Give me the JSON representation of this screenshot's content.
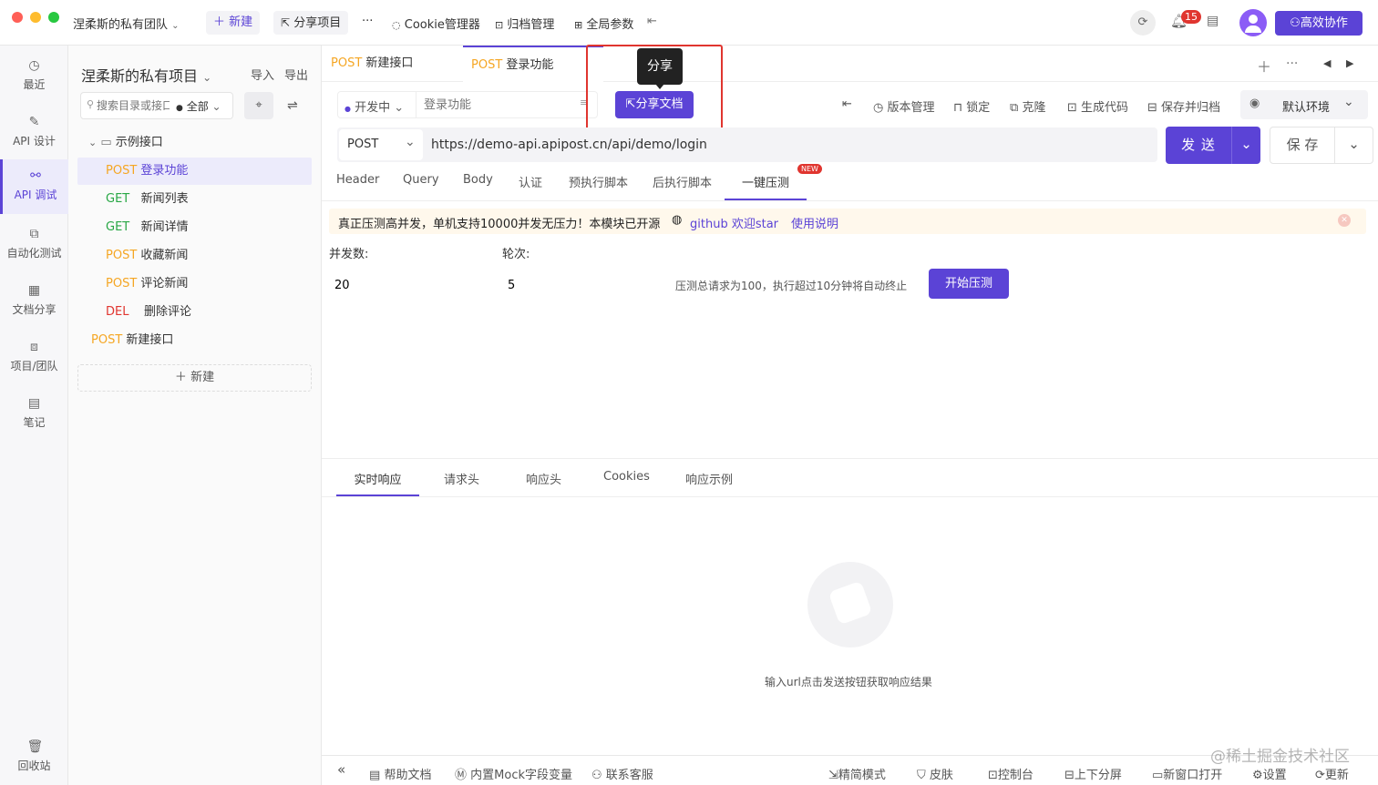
{
  "titlebar": {
    "team": "涅柔斯的私有团队",
    "new_label": "新建",
    "share_project": "分享项目",
    "more": "···",
    "cookie": "Cookie管理器",
    "archive": "归档管理",
    "global_params": "全局参数",
    "notif_count": "15",
    "collab": "高效协作"
  },
  "leftnav": [
    {
      "label": "最近",
      "icon": "clock-icon"
    },
    {
      "label": "API 设计",
      "icon": "edit-icon"
    },
    {
      "label": "API 调试",
      "icon": "link-icon"
    },
    {
      "label": "自动化测试",
      "icon": "flow-icon"
    },
    {
      "label": "文档分享",
      "icon": "doc-icon"
    },
    {
      "label": "项目/团队",
      "icon": "stack-icon"
    },
    {
      "label": "笔记",
      "icon": "note-icon"
    },
    {
      "label": "回收站",
      "icon": "trash-icon"
    }
  ],
  "tree": {
    "project": "涅柔斯的私有项目",
    "import": "导入",
    "export": "导出",
    "search_placeholder": "搜索目录或接口",
    "filter": "全部",
    "folder": "示例接口",
    "items": [
      {
        "method": "POST",
        "name": "登录功能"
      },
      {
        "method": "GET",
        "name": "新闻列表"
      },
      {
        "method": "GET",
        "name": "新闻详情"
      },
      {
        "method": "POST",
        "name": "收藏新闻"
      },
      {
        "method": "POST",
        "name": "评论新闻"
      },
      {
        "method": "DEL",
        "name": "删除评论"
      }
    ],
    "root_item": {
      "method": "POST",
      "name": "新建接口"
    },
    "new_button": "新建"
  },
  "tabs": [
    {
      "method": "POST",
      "name": "新建接口"
    },
    {
      "method": "POST",
      "name": "登录功能"
    }
  ],
  "tooltip": "分享",
  "toolbar": {
    "status": "开发中",
    "name_placeholder": "登录功能",
    "share_doc": "分享文档",
    "version": "版本管理",
    "lock": "锁定",
    "clone": "克隆",
    "gen_code": "生成代码",
    "save_archive": "保存并归档",
    "env": "默认环境"
  },
  "request": {
    "method": "POST",
    "url": "https://demo-api.apipost.cn/api/demo/login",
    "send": "发 送",
    "save": "保 存"
  },
  "subtabs": [
    "Header",
    "Query",
    "Body",
    "认证",
    "预执行脚本",
    "后执行脚本",
    "一键压测"
  ],
  "new_badge": "NEW",
  "banner": {
    "text": "真正压测高并发，单机支持10000并发无压力！本模块已开源",
    "github": "github 欢迎star",
    "usage": "使用说明"
  },
  "stress": {
    "concurrency_label": "并发数:",
    "rounds_label": "轮次:",
    "concurrency": "20",
    "rounds": "5",
    "hint": "压测总请求为100，执行超过10分钟将自动终止",
    "start": "开始压测"
  },
  "response_tabs": [
    "实时响应",
    "请求头",
    "响应头",
    "Cookies",
    "响应示例"
  ],
  "empty_hint": "输入url点击发送按钮获取响应结果",
  "bottombar": {
    "collapse": "«",
    "help": "帮助文档",
    "mock": "内置Mock字段变量",
    "support": "联系客服",
    "simple": "精简模式",
    "skin": "皮肤",
    "console": "控制台",
    "split": "上下分屏",
    "new_window": "新窗口打开",
    "settings": "设置",
    "update": "更新"
  },
  "watermark": "@稀土掘金技术社区",
  "colors": {
    "accent": "#5b43d6",
    "post": "#f5a623",
    "get": "#28a745",
    "del": "#e0352f",
    "highlight": "#e0352f"
  }
}
